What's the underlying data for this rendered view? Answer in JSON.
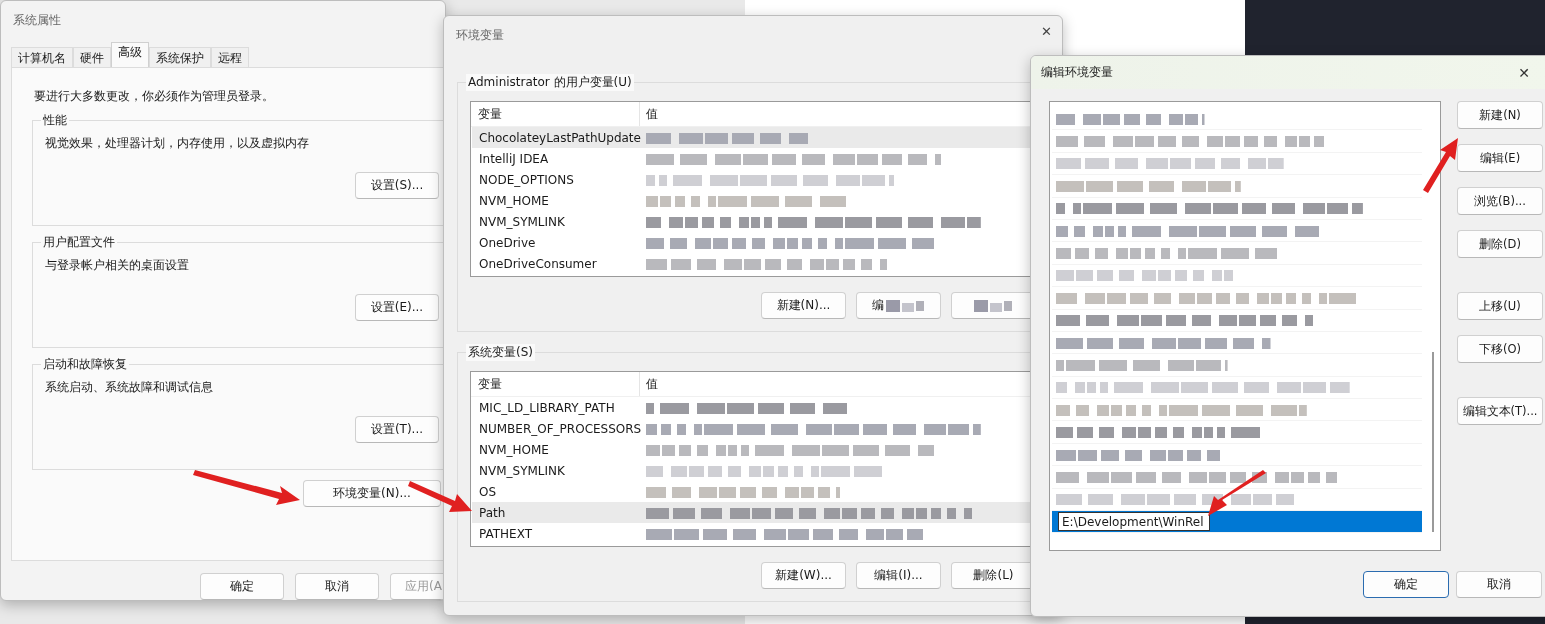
{
  "system_properties": {
    "title": "系统属性",
    "tabs": [
      {
        "label": "计算机名",
        "selected": false
      },
      {
        "label": "硬件",
        "selected": false
      },
      {
        "label": "高级",
        "selected": true
      },
      {
        "label": "系统保护",
        "selected": false
      },
      {
        "label": "远程",
        "selected": false
      }
    ],
    "notice": "要进行大多数更改，你必须作为管理员登录。",
    "groups": [
      {
        "title": "性能",
        "description": "视觉效果，处理器计划，内存使用，以及虚拟内存",
        "button": "设置(S)..."
      },
      {
        "title": "用户配置文件",
        "description": "与登录帐户相关的桌面设置",
        "button": "设置(E)..."
      },
      {
        "title": "启动和故障恢复",
        "description": "系统启动、系统故障和调试信息",
        "button": "设置(T)..."
      }
    ],
    "env_button": "环境变量(N)...",
    "buttons": [
      {
        "label": "确定",
        "disabled": false
      },
      {
        "label": "取消",
        "disabled": false
      },
      {
        "label": "应用(A",
        "disabled": true
      }
    ]
  },
  "environment_variables": {
    "title": "环境变量",
    "sections": [
      {
        "title": "Administrator 的用户变量(U)",
        "columns": [
          "变量",
          "值"
        ],
        "rows": [
          {
            "name": "ChocolateyLastPathUpdate",
            "selected": true
          },
          {
            "name": "IntelliJ IDEA",
            "selected": false
          },
          {
            "name": "NODE_OPTIONS",
            "selected": false
          },
          {
            "name": "NVM_HOME",
            "selected": false
          },
          {
            "name": "NVM_SYMLINK",
            "selected": false
          },
          {
            "name": "OneDrive",
            "selected": false
          },
          {
            "name": "OneDriveConsumer",
            "selected": false
          }
        ],
        "buttons": [
          {
            "label": "新建(N)...",
            "redacted": false
          },
          {
            "label": "编",
            "redacted": true
          },
          {
            "redacted": true
          }
        ]
      },
      {
        "title": "系统变量(S)",
        "columns": [
          "变量",
          "值"
        ],
        "rows": [
          {
            "name": "MIC_LD_LIBRARY_PATH",
            "selected": false
          },
          {
            "name": "NUMBER_OF_PROCESSORS",
            "selected": false
          },
          {
            "name": "NVM_HOME",
            "selected": false
          },
          {
            "name": "NVM_SYMLINK",
            "selected": false
          },
          {
            "name": "OS",
            "selected": false
          },
          {
            "name": "Path",
            "selected": true
          },
          {
            "name": "PATHEXT",
            "selected": false
          }
        ],
        "buttons": [
          {
            "label": "新建(W)...",
            "redacted": false
          },
          {
            "label": "编辑(I)...",
            "redacted": false
          },
          {
            "label": "删除(L)",
            "redacted": false
          }
        ]
      }
    ],
    "close": "✕"
  },
  "edit_variable": {
    "title": "编辑环境变量",
    "close": "✕",
    "entries": [
      {
        "kind": "redacted"
      },
      {
        "kind": "redacted"
      },
      {
        "kind": "redacted"
      },
      {
        "kind": "redacted"
      },
      {
        "kind": "redacted"
      },
      {
        "kind": "redacted"
      },
      {
        "kind": "redacted"
      },
      {
        "kind": "redacted"
      },
      {
        "kind": "redacted"
      },
      {
        "kind": "redacted"
      },
      {
        "kind": "redacted"
      },
      {
        "kind": "redacted"
      },
      {
        "kind": "redacted"
      },
      {
        "kind": "redacted"
      },
      {
        "kind": "redacted"
      },
      {
        "kind": "redacted"
      },
      {
        "kind": "redacted"
      },
      {
        "kind": "redacted"
      },
      {
        "kind": "editing",
        "value": "E:\\Development\\WinRel",
        "selected": true
      }
    ],
    "side_buttons": [
      [
        "新建(N)",
        "编辑(E)",
        "浏览(B)...",
        "删除(D)"
      ],
      [
        "上移(U)",
        "下移(O)"
      ],
      [
        "编辑文本(T)..."
      ]
    ],
    "buttons": [
      "确定",
      "取消"
    ]
  }
}
